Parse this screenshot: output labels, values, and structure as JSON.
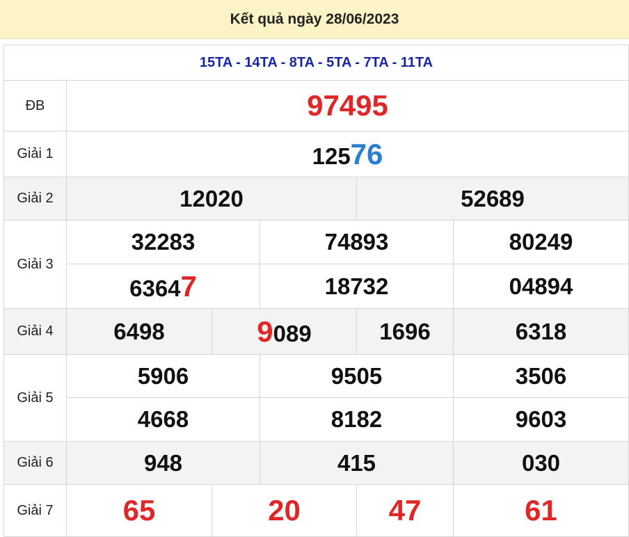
{
  "header": {
    "title": "Kết quả ngày 28/06/2023"
  },
  "codes": "15TA - 14TA - 8TA - 5TA - 7TA - 11TA",
  "prizes": {
    "db": {
      "label": "ĐB",
      "value": "97495"
    },
    "g1": {
      "label": "Giải 1",
      "value_plain": "125",
      "value_highlight": "76"
    },
    "g2": {
      "label": "Giải 2",
      "values": [
        "12020",
        "52689"
      ]
    },
    "g3": {
      "label": "Giải 3",
      "row1": [
        "32283",
        "74893",
        "80249"
      ],
      "row2_first_plain": "6364",
      "row2_first_highlight": "7",
      "row2_rest": [
        "18732",
        "04894"
      ]
    },
    "g4": {
      "label": "Giải 4",
      "first": "6498",
      "second_highlight": "9",
      "second_plain": "089",
      "rest": [
        "1696",
        "6318"
      ]
    },
    "g5": {
      "label": "Giải 5",
      "row1": [
        "5906",
        "9505",
        "3506"
      ],
      "row2": [
        "4668",
        "8182",
        "9603"
      ]
    },
    "g6": {
      "label": "Giải 6",
      "values": [
        "948",
        "415",
        "030"
      ]
    },
    "g7": {
      "label": "Giải 7",
      "values": [
        "65",
        "20",
        "47",
        "61"
      ]
    }
  },
  "colors": {
    "header_bg": "#fcf3c6",
    "codes": "#1a25a6",
    "highlight_red": "#e02727",
    "highlight_blue": "#2a7fd1",
    "alt_row_bg": "#f3f3f3"
  }
}
